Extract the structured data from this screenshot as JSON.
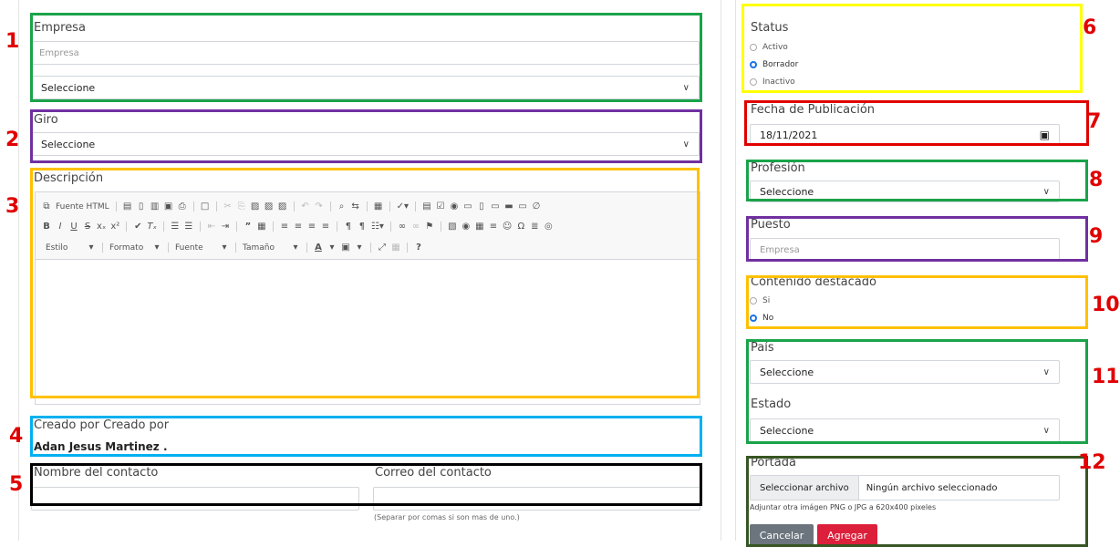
{
  "left": {
    "empresa_label": "Empresa",
    "empresa_placeholder": "Empresa",
    "empresa_select": "Seleccione",
    "giro_label": "Giro",
    "giro_select": "Seleccione",
    "descripcion_label": "Descripción",
    "toolbar": {
      "row1": [
        "Fuente HTML"
      ],
      "style_dropdowns": [
        "Estilo",
        "Formato",
        "Fuente",
        "Tamaño"
      ]
    },
    "creado_label": "Creado por Creado por",
    "creado_value": "Adan Jesus Martinez .",
    "contacto_label": "Nombre del contacto",
    "correo_label": "Correo del contacto",
    "correo_hint": "(Separar por comas si son mas de uno.)"
  },
  "right": {
    "status_label": "Status",
    "status_options": [
      "Activo",
      "Borrador",
      "Inactivo"
    ],
    "status_selected": "Borrador",
    "fecha_label": "Fecha de Publicación",
    "fecha_value": "18/11/2021",
    "profesion_label": "Profesión",
    "profesion_select": "Seleccione",
    "puesto_label": "Puesto",
    "puesto_placeholder": "Empresa",
    "destacado_label": "Contenido destacado",
    "destacado_options": [
      "Si",
      "No"
    ],
    "destacado_selected": "No",
    "pais_label": "País",
    "pais_select": "Seleccione",
    "estado_label": "Estado",
    "estado_select": "Seleccione",
    "portada_label": "Portada",
    "file_button": "Seleccionar archivo",
    "file_status": "Ningún archivo seleccionado",
    "file_hint": "Adjuntar otra imágen PNG o JPG a 620x400 pixeles",
    "cancel_label": "Cancelar",
    "add_label": "Agregar"
  },
  "annotations": [
    "1",
    "2",
    "3",
    "4",
    "5",
    "6",
    "7",
    "8",
    "9",
    "10",
    "11",
    "12"
  ],
  "colors": {
    "green": "#1aa34a",
    "purple": "#7030a0",
    "orange": "#ffc000",
    "blue": "#00b0f0",
    "black": "#000000",
    "yellow": "#ffff00",
    "red": "#e00000",
    "darkgreen": "#375623",
    "radio_on": "#1a73e8",
    "cancel_bg": "#6c757d",
    "add_bg": "#dc1f3a"
  }
}
